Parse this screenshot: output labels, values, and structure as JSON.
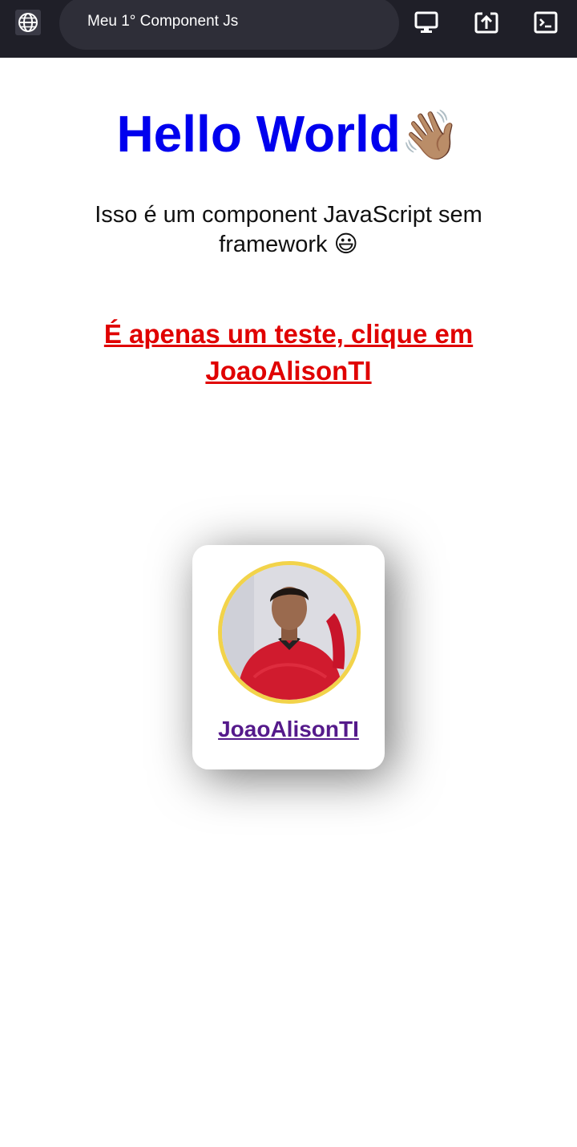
{
  "browser": {
    "page_title": "Meu 1° Component Js",
    "icons": [
      "globe-icon",
      "desktop-icon",
      "share-up-icon",
      "terminal-icon"
    ]
  },
  "main": {
    "heading": "Hello World",
    "heading_emoji": "👋🏽",
    "description": "Isso é um component JavaScript sem framework 😃",
    "notice_link": "É apenas um teste, clique em JoaoAlisonTI"
  },
  "profile_card": {
    "name": "JoaoAlisonTI"
  },
  "colors": {
    "heading": "#0000ee",
    "notice": "#e00000",
    "card_link": "#551a8b",
    "avatar_ring": "#f2d34a",
    "topbar": "#1f1f28"
  }
}
